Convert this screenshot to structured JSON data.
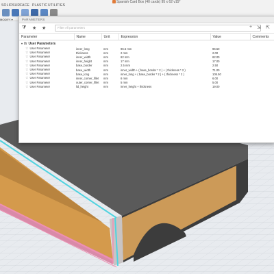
{
  "app": {
    "document_title": "Spanish Card Box (40 cards) 95 x 62 v15*",
    "tabs": [
      "SOLID",
      "SURFACE",
      "PLASTIC",
      "UTILITIES"
    ],
    "toolbar_dropdown": "MODIFY ▾"
  },
  "dialog": {
    "title": "PARAMETERS",
    "filter_placeholder": "Filter All parameters",
    "columns": {
      "parameter": "Parameter",
      "name": "Name",
      "unit": "Unit",
      "expression": "Expression",
      "value": "Value",
      "comments": "Comments"
    },
    "group_label": "User Parameters",
    "rows": [
      {
        "parameter": "User Parameter",
        "name": "inner_long",
        "unit": "mm",
        "expression": "96.5 mm",
        "value": "96.50",
        "comments": ""
      },
      {
        "parameter": "User Parameter",
        "name": "thickness",
        "unit": "mm",
        "expression": "2 mm",
        "value": "2.00",
        "comments": ""
      },
      {
        "parameter": "User Parameter",
        "name": "inner_width",
        "unit": "mm",
        "expression": "62 mm",
        "value": "62.00",
        "comments": ""
      },
      {
        "parameter": "User Parameter",
        "name": "inner_height",
        "unit": "mm",
        "expression": "17 mm",
        "value": "17.00",
        "comments": ""
      },
      {
        "parameter": "User Parameter",
        "name": "base_border",
        "unit": "mm",
        "expression": "2.5 mm",
        "value": "2.50",
        "comments": ""
      },
      {
        "parameter": "User Parameter",
        "name": "base_width",
        "unit": "mm",
        "expression": "inner_width + ( base_border * 2 ) + ( thickness * 2 )",
        "value": "71.00",
        "comments": ""
      },
      {
        "parameter": "User Parameter",
        "name": "base_long",
        "unit": "mm",
        "expression": "inner_long + ( base_border * 2 ) + ( thickness * 2 )",
        "value": "105.50",
        "comments": ""
      },
      {
        "parameter": "User Parameter",
        "name": "inner_corner_fillet",
        "unit": "mm",
        "expression": "6 mm",
        "value": "6.00",
        "comments": ""
      },
      {
        "parameter": "User Parameter",
        "name": "outer_corner_fillet",
        "unit": "mm",
        "expression": "5 mm",
        "value": "5.00",
        "comments": ""
      },
      {
        "parameter": "User Parameter",
        "name": "lid_height",
        "unit": "mm",
        "expression": "inner_height + thickness",
        "value": "19.00",
        "comments": ""
      }
    ]
  },
  "colors": {
    "model_top": "#5b5b5b",
    "model_inner": "#d6a052",
    "highlight_cyan": "#4fd3e0",
    "highlight_pink": "#ef8fb3"
  }
}
